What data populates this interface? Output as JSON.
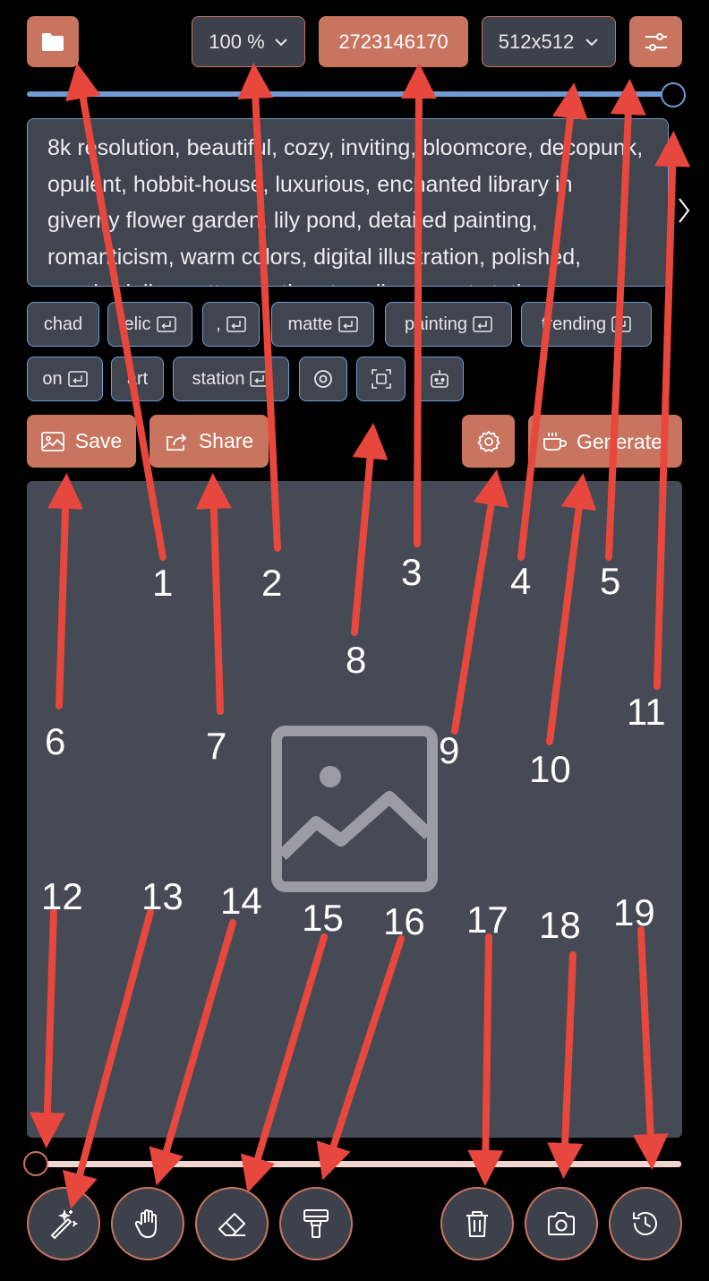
{
  "toolbar": {
    "zoom": "100 %",
    "seed": "2723146170",
    "size": "512x512"
  },
  "prompt": {
    "text": "8k resolution, beautiful, cozy, inviting, bloomcore, decopunk, opulent, hobbit-house, luxurious, enchanted library in giverny flower garden, lily pond, detailed painting, romanticism, warm colors, digital illustration, polished, psychedelic, matte painting, trending on art station"
  },
  "chips": {
    "row1": [
      "chad",
      "elic",
      ",",
      "matte",
      "painting",
      "trending"
    ],
    "row2": [
      "on",
      "art",
      "station"
    ]
  },
  "actions": {
    "save": "Save",
    "share": "Share",
    "generate": "Generate"
  },
  "annotations": [
    "1",
    "2",
    "3",
    "4",
    "5",
    "6",
    "7",
    "8",
    "9",
    "10",
    "11",
    "12",
    "13",
    "14",
    "15",
    "16",
    "17",
    "18",
    "19"
  ],
  "colors": {
    "accent": "#c8745f",
    "panel": "#3d414b",
    "slider_blue": "#6e9bd4",
    "arrow": "#e8473d"
  }
}
